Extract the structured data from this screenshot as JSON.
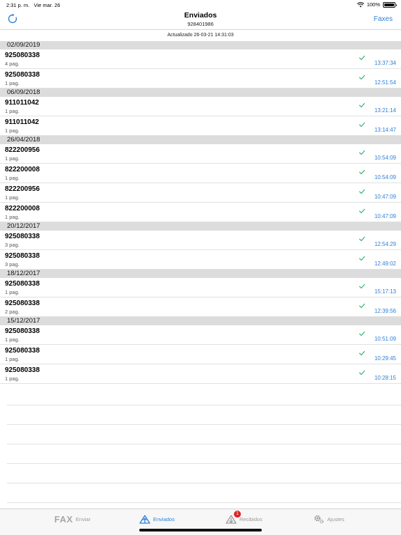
{
  "status_bar": {
    "time": "2:31 p. m.",
    "date": "Vie mar. 26",
    "battery": "100%"
  },
  "nav": {
    "title": "Enviados",
    "subtitle": "928401986",
    "right_button": "Faxes",
    "left_icon": "refresh-icon"
  },
  "updated": "Actualizado 26-03-21 14:31:03",
  "sections": [
    {
      "date": "02/09/2019",
      "rows": [
        {
          "number": "925080338",
          "pages": "4 pag.",
          "time": "13:37:34"
        },
        {
          "number": "925080338",
          "pages": "1 pag.",
          "time": "12:51:54"
        }
      ]
    },
    {
      "date": "06/09/2018",
      "rows": [
        {
          "number": "911011042",
          "pages": "1 pag.",
          "time": "13:21:14"
        },
        {
          "number": "911011042",
          "pages": "1 pag.",
          "time": "13:14:47"
        }
      ]
    },
    {
      "date": "26/04/2018",
      "rows": [
        {
          "number": "822200956",
          "pages": "1 pag.",
          "time": "10:54:09"
        },
        {
          "number": "822200008",
          "pages": "1 pag.",
          "time": "10:54:09"
        },
        {
          "number": "822200956",
          "pages": "1 pag.",
          "time": "10:47:09"
        },
        {
          "number": "822200008",
          "pages": "1 pag.",
          "time": "10:47:09"
        }
      ]
    },
    {
      "date": "20/12/2017",
      "rows": [
        {
          "number": "925080338",
          "pages": "3 pag.",
          "time": "12:54:29"
        },
        {
          "number": "925080338",
          "pages": "3 pag.",
          "time": "12:49:02"
        }
      ]
    },
    {
      "date": "18/12/2017",
      "rows": [
        {
          "number": "925080338",
          "pages": "1 pag.",
          "time": "15:17:13"
        },
        {
          "number": "925080338",
          "pages": "2 pag.",
          "time": "12:39:56"
        }
      ]
    },
    {
      "date": "15/12/2017",
      "rows": [
        {
          "number": "925080338",
          "pages": "1 pag.",
          "time": "10:51:09"
        },
        {
          "number": "925080338",
          "pages": "1 pag.",
          "time": "10:29:45"
        },
        {
          "number": "925080338",
          "pages": "1 pag.",
          "time": "10:28:15"
        }
      ]
    }
  ],
  "tabs": [
    {
      "logo": "FAX",
      "label": "Enviar",
      "icon": "fax-logo-icon",
      "active": false
    },
    {
      "label": "Enviados",
      "icon": "sent-icon",
      "active": true
    },
    {
      "label": "Recibidos",
      "icon": "received-icon",
      "badge": "1",
      "active": false
    },
    {
      "label": "Ajustes",
      "icon": "gear-icon",
      "active": false
    }
  ],
  "colors": {
    "accent": "#2f7fd6",
    "check": "#3cb371",
    "section_bg": "#dcdcdc",
    "badge": "#e02020"
  }
}
